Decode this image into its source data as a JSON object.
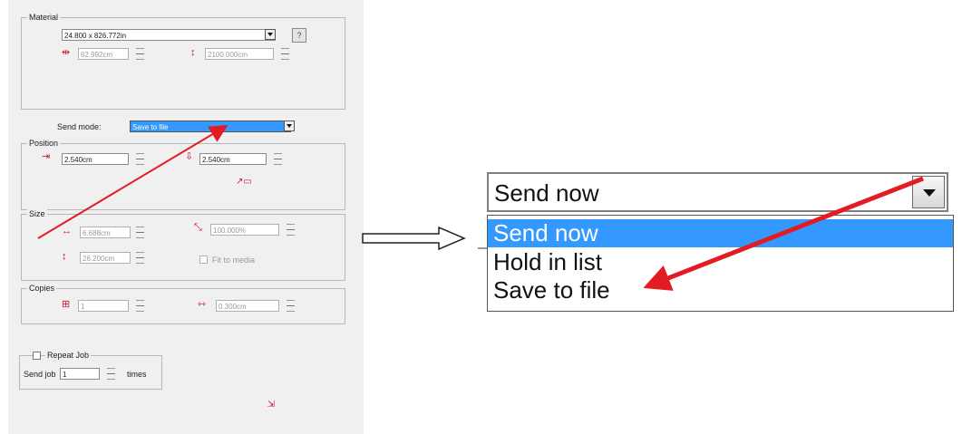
{
  "material": {
    "group_title": "Material",
    "media_value": "24.800 x 826.772in",
    "width_value": "62.992cm",
    "length_value": "2100.000cm"
  },
  "send_mode": {
    "label": "Send mode:",
    "value": "Save to file"
  },
  "position": {
    "group_title": "Position",
    "x_value": "2.540cm",
    "y_value": "2.540cm"
  },
  "size": {
    "group_title": "Size",
    "width_value": "6.688cm",
    "scale_value": "100.000%",
    "height_value": "26.200cm",
    "fit_label": "Fit to media"
  },
  "copies": {
    "group_title": "Copies",
    "count_value": "1",
    "spacing_value": "0.300cm"
  },
  "repeat": {
    "checkbox_label": "Repeat Job",
    "send_job_label": "Send job",
    "times_value": "1",
    "times_label": "times"
  },
  "zoom_dropdown": {
    "current_value": "Send now",
    "options": [
      "Send now",
      "Hold in list",
      "Save to file"
    ],
    "highlighted_index": 0
  },
  "colors": {
    "annotation_arrow": "#e31b23",
    "highlight": "#3399ff",
    "panel_bg": "#f0f0f0"
  }
}
